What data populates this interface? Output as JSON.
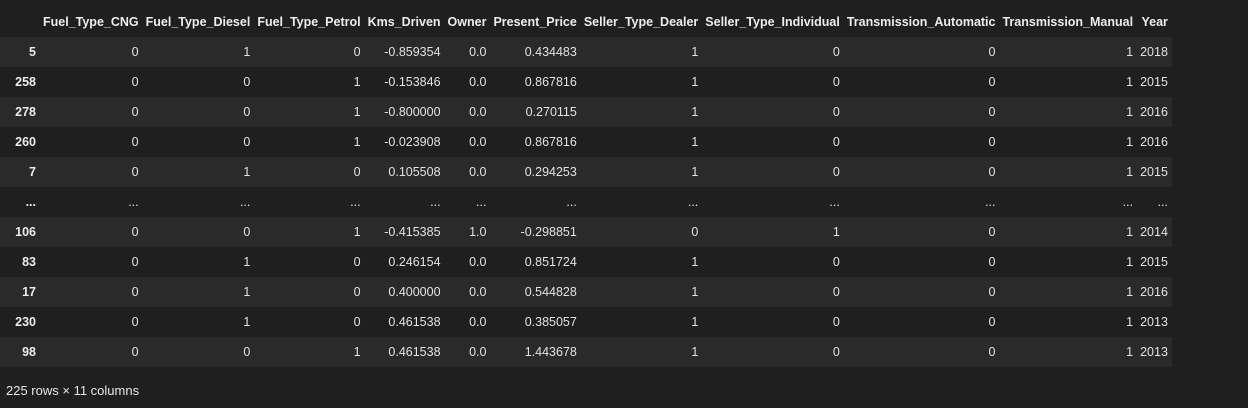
{
  "table": {
    "columns": [
      "",
      "Fuel_Type_CNG",
      "Fuel_Type_Diesel",
      "Fuel_Type_Petrol",
      "Kms_Driven",
      "Owner",
      "Present_Price",
      "Seller_Type_Dealer",
      "Seller_Type_Individual",
      "Transmission_Automatic",
      "Transmission_Manual",
      "Year"
    ],
    "rows": [
      {
        "index": "5",
        "cells": [
          "0",
          "1",
          "0",
          "-0.859354",
          "0.0",
          "0.434483",
          "1",
          "0",
          "0",
          "1",
          "2018"
        ]
      },
      {
        "index": "258",
        "cells": [
          "0",
          "0",
          "1",
          "-0.153846",
          "0.0",
          "0.867816",
          "1",
          "0",
          "0",
          "1",
          "2015"
        ]
      },
      {
        "index": "278",
        "cells": [
          "0",
          "0",
          "1",
          "-0.800000",
          "0.0",
          "0.270115",
          "1",
          "0",
          "0",
          "1",
          "2016"
        ]
      },
      {
        "index": "260",
        "cells": [
          "0",
          "0",
          "1",
          "-0.023908",
          "0.0",
          "0.867816",
          "1",
          "0",
          "0",
          "1",
          "2016"
        ]
      },
      {
        "index": "7",
        "cells": [
          "0",
          "1",
          "0",
          "0.105508",
          "0.0",
          "0.294253",
          "1",
          "0",
          "0",
          "1",
          "2015"
        ]
      },
      {
        "index": "...",
        "cells": [
          "...",
          "...",
          "...",
          "...",
          "...",
          "...",
          "...",
          "...",
          "...",
          "...",
          "..."
        ]
      },
      {
        "index": "106",
        "cells": [
          "0",
          "0",
          "1",
          "-0.415385",
          "1.0",
          "-0.298851",
          "0",
          "1",
          "0",
          "1",
          "2014"
        ]
      },
      {
        "index": "83",
        "cells": [
          "0",
          "1",
          "0",
          "0.246154",
          "0.0",
          "0.851724",
          "1",
          "0",
          "0",
          "1",
          "2015"
        ]
      },
      {
        "index": "17",
        "cells": [
          "0",
          "1",
          "0",
          "0.400000",
          "0.0",
          "0.544828",
          "1",
          "0",
          "0",
          "1",
          "2016"
        ]
      },
      {
        "index": "230",
        "cells": [
          "0",
          "1",
          "0",
          "0.461538",
          "0.0",
          "0.385057",
          "1",
          "0",
          "0",
          "1",
          "2013"
        ]
      },
      {
        "index": "98",
        "cells": [
          "0",
          "0",
          "1",
          "0.461538",
          "0.0",
          "1.443678",
          "1",
          "0",
          "0",
          "1",
          "2013"
        ]
      }
    ]
  },
  "footer": {
    "shape_text": "225 rows × 11 columns"
  },
  "colors": {
    "background": "#1f1f1f",
    "row_stripe": "#2a2a2a",
    "text": "#e6e6e6"
  }
}
